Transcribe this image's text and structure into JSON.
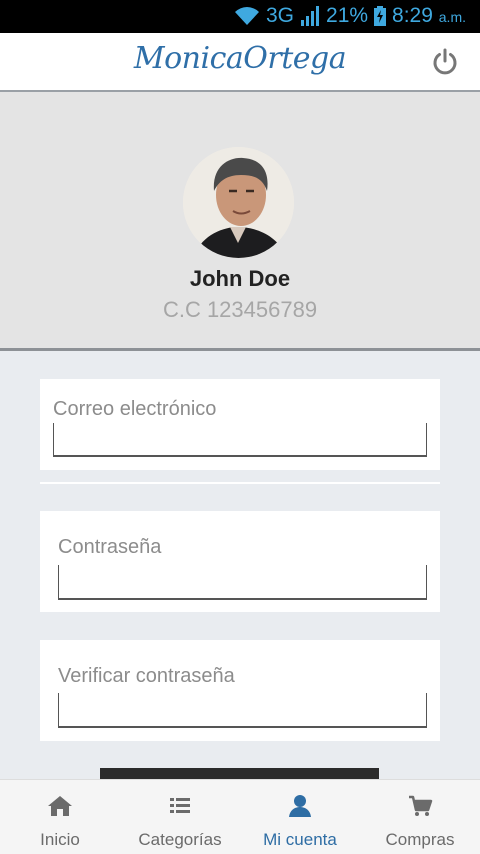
{
  "status_bar": {
    "network": "3G",
    "battery": "21%",
    "time": "8:29",
    "ampm": "a.m."
  },
  "header": {
    "brand": "MonicaOrtega",
    "power_icon": "power-icon"
  },
  "profile": {
    "name": "John Doe",
    "id": "C.C 123456789"
  },
  "form": {
    "email_label": "Correo electrónico",
    "email_value": "",
    "password_label": "Contraseña",
    "password_value": "",
    "verify_label": "Verificar contraseña",
    "verify_value": ""
  },
  "nav": {
    "items": [
      {
        "label": "Inicio",
        "icon": "home-icon"
      },
      {
        "label": "Categorías",
        "icon": "list-icon"
      },
      {
        "label": "Mi cuenta",
        "icon": "user-icon",
        "active": true
      },
      {
        "label": "Compras",
        "icon": "cart-icon"
      }
    ]
  },
  "colors": {
    "accent": "#2e6da4",
    "status": "#3fa9e0"
  }
}
